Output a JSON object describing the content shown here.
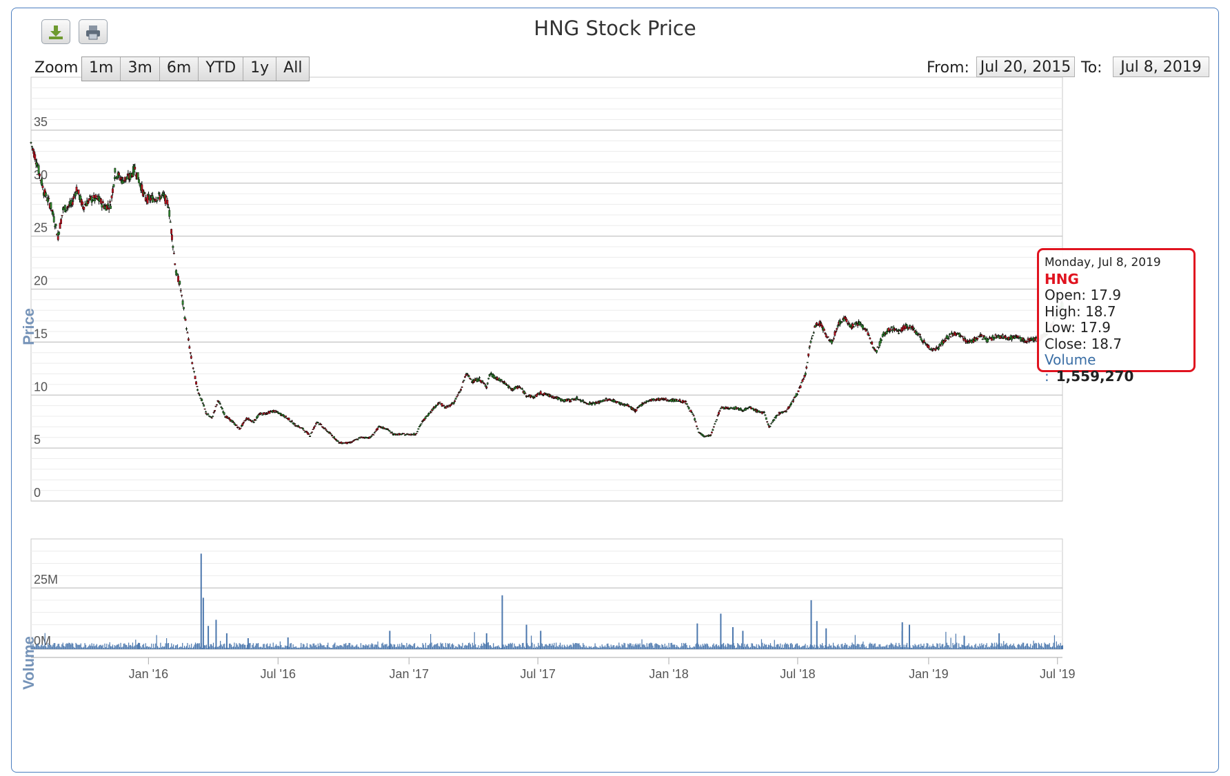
{
  "title": "HNG Stock Price",
  "toolbar": {
    "download_icon": "download-icon",
    "print_icon": "print-icon"
  },
  "zoom": {
    "label": "Zoom",
    "options": [
      "1m",
      "3m",
      "6m",
      "YTD",
      "1y",
      "All"
    ]
  },
  "range": {
    "from_label": "From:",
    "from_value": "Jul 20, 2015",
    "to_label": "To:",
    "to_value": "Jul 8, 2019"
  },
  "tooltip": {
    "date": "Monday, Jul 8, 2019",
    "series": "HNG",
    "open": "Open: 17.9",
    "high": "High: 18.7",
    "low": "Low: 17.9",
    "close": "Close: 18.7",
    "volume_label": "Volume :",
    "volume_value": "1,559,270"
  },
  "colors": {
    "up": "#2f8b2f",
    "down": "#c0111f",
    "volume": "#4b77ad",
    "frame": "#4a7dbf",
    "axis_title": "#7593b8",
    "tooltip_border": "#e0131f"
  },
  "chart_data": [
    {
      "type": "candlestick",
      "title": "HNG Stock Price",
      "ylabel": "Price",
      "ylim": [
        0,
        40
      ],
      "yticks": [
        0,
        5,
        10,
        15,
        20,
        25,
        30,
        35
      ],
      "xlim": [
        "2015-07-20",
        "2019-07-08"
      ],
      "xticks": [
        {
          "date": "2016-01-01",
          "label": "Jan '16"
        },
        {
          "date": "2016-07-01",
          "label": "Jul '16"
        },
        {
          "date": "2017-01-01",
          "label": "Jan '17"
        },
        {
          "date": "2017-07-01",
          "label": "Jul '17"
        },
        {
          "date": "2018-01-01",
          "label": "Jan '18"
        },
        {
          "date": "2018-07-01",
          "label": "Jul '18"
        },
        {
          "date": "2019-01-01",
          "label": "Jan '19"
        },
        {
          "date": "2019-07-01",
          "label": "Jul '19"
        }
      ],
      "grid": true,
      "series": [
        {
          "name": "HNG",
          "close_points": [
            [
              "2015-07-20",
              33.8
            ],
            [
              "2015-07-28",
              32.0
            ],
            [
              "2015-08-07",
              29.2
            ],
            [
              "2015-08-17",
              27.8
            ],
            [
              "2015-08-27",
              25.0
            ],
            [
              "2015-09-03",
              27.5
            ],
            [
              "2015-09-15",
              28.0
            ],
            [
              "2015-09-22",
              29.5
            ],
            [
              "2015-10-01",
              27.8
            ],
            [
              "2015-10-12",
              28.5
            ],
            [
              "2015-10-22",
              28.5
            ],
            [
              "2015-11-01",
              27.8
            ],
            [
              "2015-11-09",
              28.0
            ],
            [
              "2015-11-15",
              31.0
            ],
            [
              "2015-11-25",
              30.3
            ],
            [
              "2015-12-05",
              30.5
            ],
            [
              "2015-12-13",
              31.4
            ],
            [
              "2015-12-20",
              30.0
            ],
            [
              "2015-12-28",
              28.5
            ],
            [
              "2016-01-10",
              28.6
            ],
            [
              "2016-01-22",
              28.8
            ],
            [
              "2016-01-29",
              28.0
            ],
            [
              "2016-02-03",
              25.0
            ],
            [
              "2016-02-09",
              21.5
            ],
            [
              "2016-02-14",
              20.5
            ],
            [
              "2016-02-22",
              17.0
            ],
            [
              "2016-03-01",
              13.5
            ],
            [
              "2016-03-10",
              10.5
            ],
            [
              "2016-03-16",
              9.5
            ],
            [
              "2016-03-22",
              8.3
            ],
            [
              "2016-03-30",
              7.8
            ],
            [
              "2016-04-08",
              9.5
            ],
            [
              "2016-04-18",
              8.0
            ],
            [
              "2016-04-28",
              7.5
            ],
            [
              "2016-05-08",
              6.8
            ],
            [
              "2016-05-18",
              7.8
            ],
            [
              "2016-05-28",
              7.5
            ],
            [
              "2016-06-05",
              8.2
            ],
            [
              "2016-06-15",
              8.3
            ],
            [
              "2016-06-25",
              8.5
            ],
            [
              "2016-07-05",
              8.2
            ],
            [
              "2016-07-15",
              7.8
            ],
            [
              "2016-07-25",
              7.2
            ],
            [
              "2016-08-05",
              6.8
            ],
            [
              "2016-08-15",
              6.2
            ],
            [
              "2016-08-25",
              7.5
            ],
            [
              "2016-09-05",
              6.8
            ],
            [
              "2016-09-15",
              6.2
            ],
            [
              "2016-09-25",
              5.5
            ],
            [
              "2016-10-10",
              5.5
            ],
            [
              "2016-10-25",
              6.0
            ],
            [
              "2016-11-08",
              6.0
            ],
            [
              "2016-11-20",
              7.0
            ],
            [
              "2016-12-01",
              6.8
            ],
            [
              "2016-12-10",
              6.3
            ],
            [
              "2016-12-25",
              6.3
            ],
            [
              "2017-01-10",
              6.3
            ],
            [
              "2017-01-20",
              7.5
            ],
            [
              "2017-02-01",
              8.5
            ],
            [
              "2017-02-12",
              9.3
            ],
            [
              "2017-02-22",
              8.8
            ],
            [
              "2017-03-05",
              9.3
            ],
            [
              "2017-03-15",
              10.5
            ],
            [
              "2017-03-22",
              12.0
            ],
            [
              "2017-04-01",
              11.3
            ],
            [
              "2017-04-10",
              11.5
            ],
            [
              "2017-04-20",
              10.8
            ],
            [
              "2017-04-25",
              12.0
            ],
            [
              "2017-05-05",
              11.5
            ],
            [
              "2017-05-15",
              11.2
            ],
            [
              "2017-05-25",
              10.5
            ],
            [
              "2017-06-05",
              10.8
            ],
            [
              "2017-06-15",
              10.0
            ],
            [
              "2017-06-25",
              9.8
            ],
            [
              "2017-07-05",
              10.2
            ],
            [
              "2017-07-15",
              10.0
            ],
            [
              "2017-07-25",
              9.8
            ],
            [
              "2017-08-05",
              9.5
            ],
            [
              "2017-08-15",
              9.5
            ],
            [
              "2017-08-25",
              9.7
            ],
            [
              "2017-09-05",
              9.3
            ],
            [
              "2017-09-15",
              9.2
            ],
            [
              "2017-09-25",
              9.3
            ],
            [
              "2017-10-05",
              9.6
            ],
            [
              "2017-10-15",
              9.5
            ],
            [
              "2017-10-25",
              9.2
            ],
            [
              "2017-11-05",
              9.0
            ],
            [
              "2017-11-15",
              8.5
            ],
            [
              "2017-11-25",
              9.2
            ],
            [
              "2017-12-05",
              9.5
            ],
            [
              "2017-12-15",
              9.6
            ],
            [
              "2017-12-25",
              9.6
            ],
            [
              "2018-01-05",
              9.5
            ],
            [
              "2018-01-15",
              9.5
            ],
            [
              "2018-01-25",
              9.3
            ],
            [
              "2018-02-05",
              8.0
            ],
            [
              "2018-02-12",
              6.5
            ],
            [
              "2018-02-20",
              6.1
            ],
            [
              "2018-03-01",
              6.2
            ],
            [
              "2018-03-08",
              7.5
            ],
            [
              "2018-03-15",
              8.8
            ],
            [
              "2018-03-25",
              8.8
            ],
            [
              "2018-04-05",
              8.8
            ],
            [
              "2018-04-15",
              8.6
            ],
            [
              "2018-04-25",
              8.8
            ],
            [
              "2018-05-05",
              8.5
            ],
            [
              "2018-05-15",
              8.3
            ],
            [
              "2018-05-22",
              7.0
            ],
            [
              "2018-05-30",
              7.8
            ],
            [
              "2018-06-05",
              8.3
            ],
            [
              "2018-06-15",
              8.5
            ],
            [
              "2018-06-25",
              9.5
            ],
            [
              "2018-07-05",
              10.8
            ],
            [
              "2018-07-12",
              12.0
            ],
            [
              "2018-07-18",
              14.5
            ],
            [
              "2018-07-25",
              16.5
            ],
            [
              "2018-08-03",
              16.8
            ],
            [
              "2018-08-10",
              15.5
            ],
            [
              "2018-08-18",
              15.0
            ],
            [
              "2018-08-28",
              16.8
            ],
            [
              "2018-09-05",
              17.2
            ],
            [
              "2018-09-15",
              16.5
            ],
            [
              "2018-09-25",
              16.8
            ],
            [
              "2018-10-05",
              16.2
            ],
            [
              "2018-10-12",
              15.0
            ],
            [
              "2018-10-20",
              14.2
            ],
            [
              "2018-10-30",
              15.8
            ],
            [
              "2018-11-10",
              16.3
            ],
            [
              "2018-11-20",
              16.0
            ],
            [
              "2018-11-30",
              16.5
            ],
            [
              "2018-12-10",
              16.3
            ],
            [
              "2018-12-20",
              15.5
            ],
            [
              "2018-12-28",
              14.8
            ],
            [
              "2019-01-05",
              14.3
            ],
            [
              "2019-01-15",
              14.5
            ],
            [
              "2019-01-25",
              15.3
            ],
            [
              "2019-02-05",
              15.8
            ],
            [
              "2019-02-15",
              15.6
            ],
            [
              "2019-02-25",
              15.0
            ],
            [
              "2019-03-05",
              15.2
            ],
            [
              "2019-03-15",
              15.6
            ],
            [
              "2019-03-25",
              15.2
            ],
            [
              "2019-04-05",
              15.5
            ],
            [
              "2019-04-15",
              15.5
            ],
            [
              "2019-04-25",
              15.4
            ],
            [
              "2019-05-05",
              15.5
            ],
            [
              "2019-05-15",
              15.1
            ],
            [
              "2019-05-25",
              15.3
            ],
            [
              "2019-06-05",
              15.3
            ],
            [
              "2019-06-15",
              15.7
            ],
            [
              "2019-06-25",
              16.8
            ],
            [
              "2019-07-08",
              18.7
            ]
          ]
        }
      ]
    },
    {
      "type": "bar",
      "ylabel": "Volume",
      "ylim": [
        0,
        45000000
      ],
      "yticks": [
        {
          "value": 0,
          "label": "0M"
        },
        {
          "value": 25000000,
          "label": "25M"
        }
      ],
      "baseline_volume": 1500000,
      "spikes": [
        [
          "2015-12-18",
          2500000
        ],
        [
          "2016-03-15",
          39000000
        ],
        [
          "2016-03-18",
          21000000
        ],
        [
          "2016-03-25",
          9500000
        ],
        [
          "2016-04-05",
          12000000
        ],
        [
          "2016-04-20",
          6500000
        ],
        [
          "2016-05-20",
          4500000
        ],
        [
          "2016-07-15",
          4800000
        ],
        [
          "2016-12-05",
          7500000
        ],
        [
          "2017-04-20",
          6500000
        ],
        [
          "2017-05-12",
          22000000
        ],
        [
          "2017-06-15",
          10000000
        ],
        [
          "2017-07-05",
          7500000
        ],
        [
          "2018-02-10",
          10500000
        ],
        [
          "2018-03-15",
          14500000
        ],
        [
          "2018-04-01",
          9000000
        ],
        [
          "2018-04-15",
          7500000
        ],
        [
          "2018-07-20",
          20000000
        ],
        [
          "2018-07-28",
          11500000
        ],
        [
          "2018-08-10",
          8500000
        ],
        [
          "2018-11-25",
          11000000
        ],
        [
          "2018-12-05",
          10000000
        ],
        [
          "2019-02-20",
          5500000
        ],
        [
          "2019-04-10",
          6500000
        ],
        [
          "2019-07-08",
          1559270
        ]
      ]
    }
  ]
}
